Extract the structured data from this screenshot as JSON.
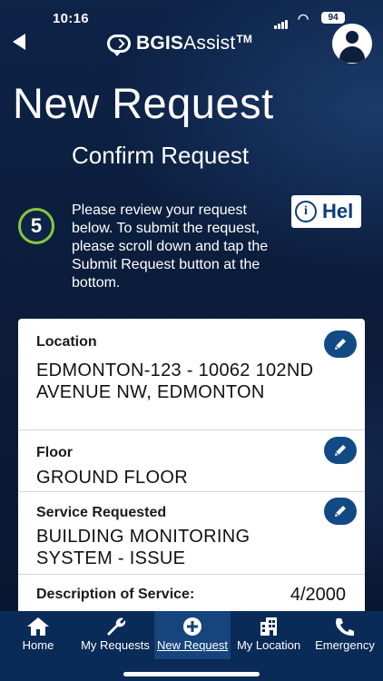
{
  "status_bar": {
    "time": "10:16",
    "battery": "94"
  },
  "header": {
    "logo_bold": "BGIS",
    "logo_regular": "Assist",
    "logo_tm": "TM"
  },
  "page": {
    "title": "New Request"
  },
  "step": {
    "number": "5",
    "title": "Confirm Request",
    "instructions": "Please review your request below. To submit the request, please scroll down and tap the Submit Request button at the bottom."
  },
  "help_button": {
    "label": "Hel"
  },
  "summary": {
    "location": {
      "label": "Location",
      "value": "EDMONTON-123 - 10062 102ND AVENUE NW, EDMONTON"
    },
    "floor": {
      "label": "Floor",
      "value": "GROUND FLOOR"
    },
    "service": {
      "label": "Service Requested",
      "value": "BUILDING MONITORING SYSTEM - ISSUE"
    },
    "description": {
      "label": "Description of Service:",
      "char_count": "4/2000"
    }
  },
  "tabs": [
    {
      "label": "Home",
      "icon": "home-icon"
    },
    {
      "label": "My Requests",
      "icon": "wrench-icon"
    },
    {
      "label": "New Request",
      "icon": "plus-circle-icon"
    },
    {
      "label": "My Location",
      "icon": "building-icon"
    },
    {
      "label": "Emergency",
      "icon": "phone-icon"
    }
  ],
  "colors": {
    "accent": "#124a86",
    "step_ring": "#8bc53f",
    "tabbar": "#0a2a57"
  }
}
